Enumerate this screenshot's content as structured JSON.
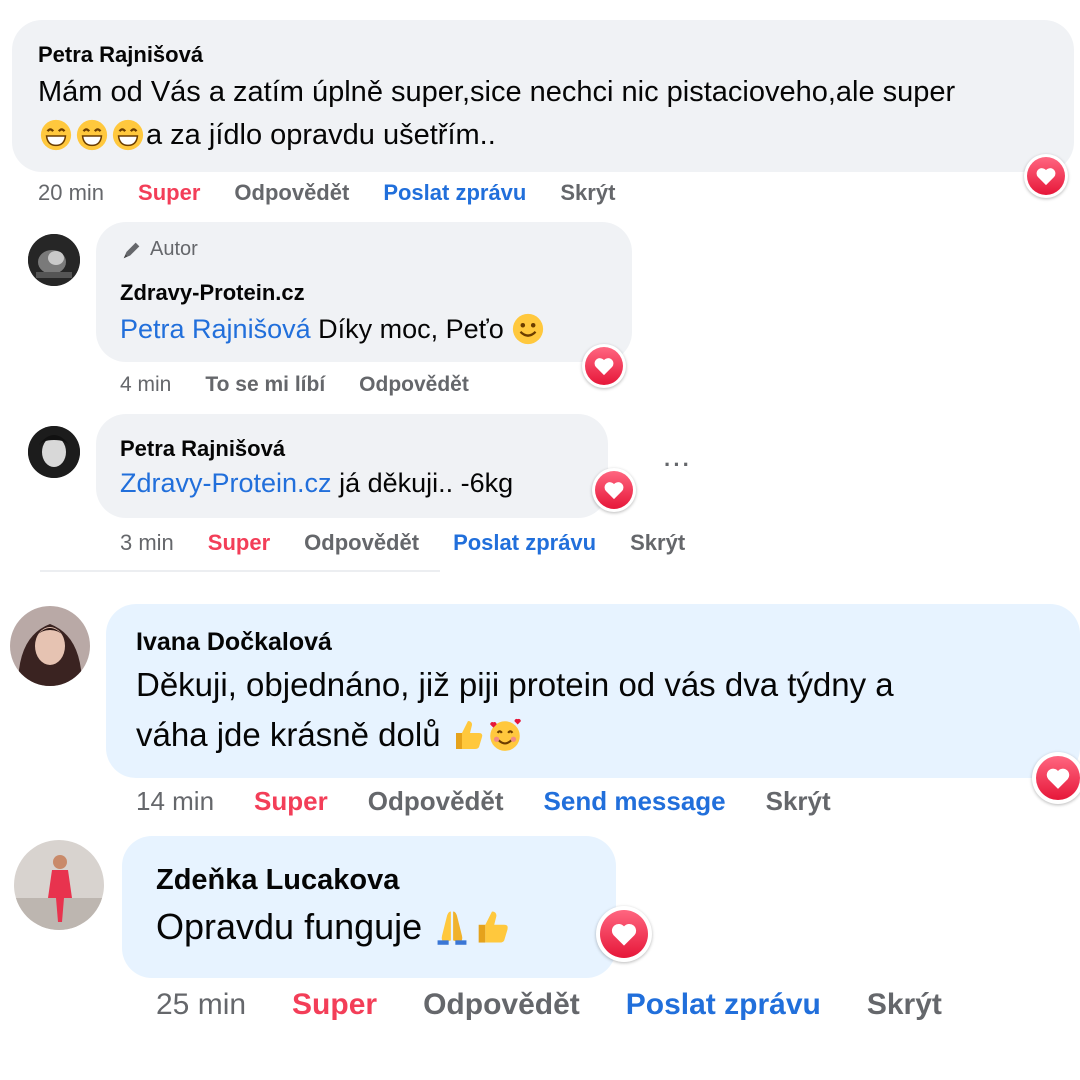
{
  "comments": [
    {
      "author": "Petra Rajnišová",
      "text_line1": "Mám od Vás a zatím úplně super,sice nechci nic pistacioveho,ale super",
      "text_line2": "a za jídlo opravdu ušetřím..",
      "time": "20 min",
      "react": "Super",
      "reply": "Odpovědět",
      "send": "Poslat zprávu",
      "hide": "Skrýt"
    },
    {
      "badge": "Autor",
      "author": "Zdravy-Protein.cz",
      "mention": "Petra Rajnišová",
      "text": " Díky moc, Peťo ",
      "time": "4 min",
      "react": "To se mi líbí",
      "reply": "Odpovědět"
    },
    {
      "author": "Petra Rajnišová",
      "mention": "Zdravy-Protein.cz",
      "text": " já děkuji.. -6kg",
      "time": "3 min",
      "react": "Super",
      "reply": "Odpovědět",
      "send": "Poslat zprávu",
      "hide": "Skrýt",
      "more": "···"
    },
    {
      "author": "Ivana Dočkalová",
      "text_line1": "Děkuji, objednáno, již piji protein od vás dva týdny a",
      "text_line2": "váha jde krásně dolů ",
      "time": "14 min",
      "react": "Super",
      "reply": "Odpovědět",
      "send": "Send message",
      "hide": "Skrýt"
    },
    {
      "author": "Zdeňka Lucakova",
      "text": "Opravdu funguje ",
      "time": "25 min",
      "react": "Super",
      "reply": "Odpovědět",
      "send": "Poslat zprávu",
      "hide": "Skrýt"
    }
  ],
  "colors": {
    "bubble_grey": "#f0f2f5",
    "bubble_blue": "#e7f3ff",
    "link_blue": "#216fdb",
    "super_red": "#f33e58",
    "meta_grey": "#65676b",
    "heart_red": "#e61739"
  },
  "icons": {
    "reaction": "heart-reaction-icon",
    "author_badge": "pencil-author-icon",
    "emoji_grin": "grinning-face-emoji",
    "emoji_smile": "smiling-face-emoji",
    "emoji_thumbs": "thumbs-up-emoji",
    "emoji_hearts": "smiling-face-with-hearts-emoji",
    "emoji_pray": "folded-hands-emoji"
  }
}
